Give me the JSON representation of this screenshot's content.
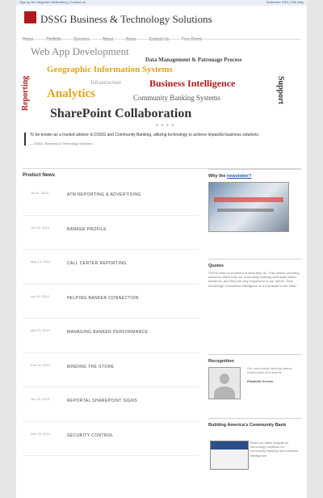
{
  "topbar": {
    "left": "Sign up for Integrated Networking | Contact us",
    "right": "Subscribe RSS | Site Map"
  },
  "site": {
    "title": "DSSG Business & Technology Solutions"
  },
  "nav": {
    "items": [
      "Home",
      "Portfolio",
      "Services",
      "About",
      "News",
      "Contact Us",
      "Free Demo"
    ]
  },
  "word_cloud": {
    "web_app": "Web App Development",
    "data_mgmt": "Data Management & Patronage Process",
    "gis": "Geographic Information Systems",
    "infrastructure": "Infrastructure",
    "bi": "Business Intelligence",
    "analytics": "Analytics",
    "cbs": "Community Banking Systems",
    "sharepoint": "SharePoint Collaboration",
    "reporting": "Reporting",
    "support": "Support",
    "dots": "● ● ● ●"
  },
  "quote": {
    "text": "To be known as a trusted advisor to DSSG and Community Banking, utilizing technology to achieve impactful business solutions.",
    "cite": "— DSSG, Business & Technology Solutions"
  },
  "products": {
    "heading": "Product News",
    "items": [
      {
        "date": "Jul 01, 2013",
        "name": "ATM REPORTING & ADVERTISING"
      },
      {
        "date": "Jun 02, 2013",
        "name": "BANKER PROFILE"
      },
      {
        "date": "May 13, 2013",
        "name": "CALL CENTER REPORTING"
      },
      {
        "date": "Apr 16, 2013",
        "name": "HELPING BANKER CONNECTION"
      },
      {
        "date": "Mar 20, 2013",
        "name": "MANAGING BANKER PERFORMANCE"
      },
      {
        "date": "Feb 18, 2013",
        "name": "MINDING THE STORE"
      },
      {
        "date": "Jan 15, 2013",
        "name": "REPORTAL SHAREPOINT SIGNS"
      },
      {
        "date": "Dec 10, 2012",
        "name": "SECURITY CONTROL"
      }
    ]
  },
  "sidebar": {
    "newsletter": {
      "title_prefix": "Why the",
      "title_link": "newsletter?"
    },
    "quotes": {
      "title": "Quotes",
      "text": "\"DSSG team is excellent at what they do. They deliver reporting solutions which help our community banking staff make better decisions, and they are very responsive to our needs. Their knowledge of business intelligence is a real asset to the bank.\""
    },
    "recognition": {
      "title": "Recognition",
      "text": "Our community banking partner testimonials and awards",
      "name": "Elizabeth Greene"
    },
    "book": {
      "title": "Building America's Community Bank",
      "text": "Read our latest insights on technology solutions for community banking and business intelligence."
    }
  }
}
